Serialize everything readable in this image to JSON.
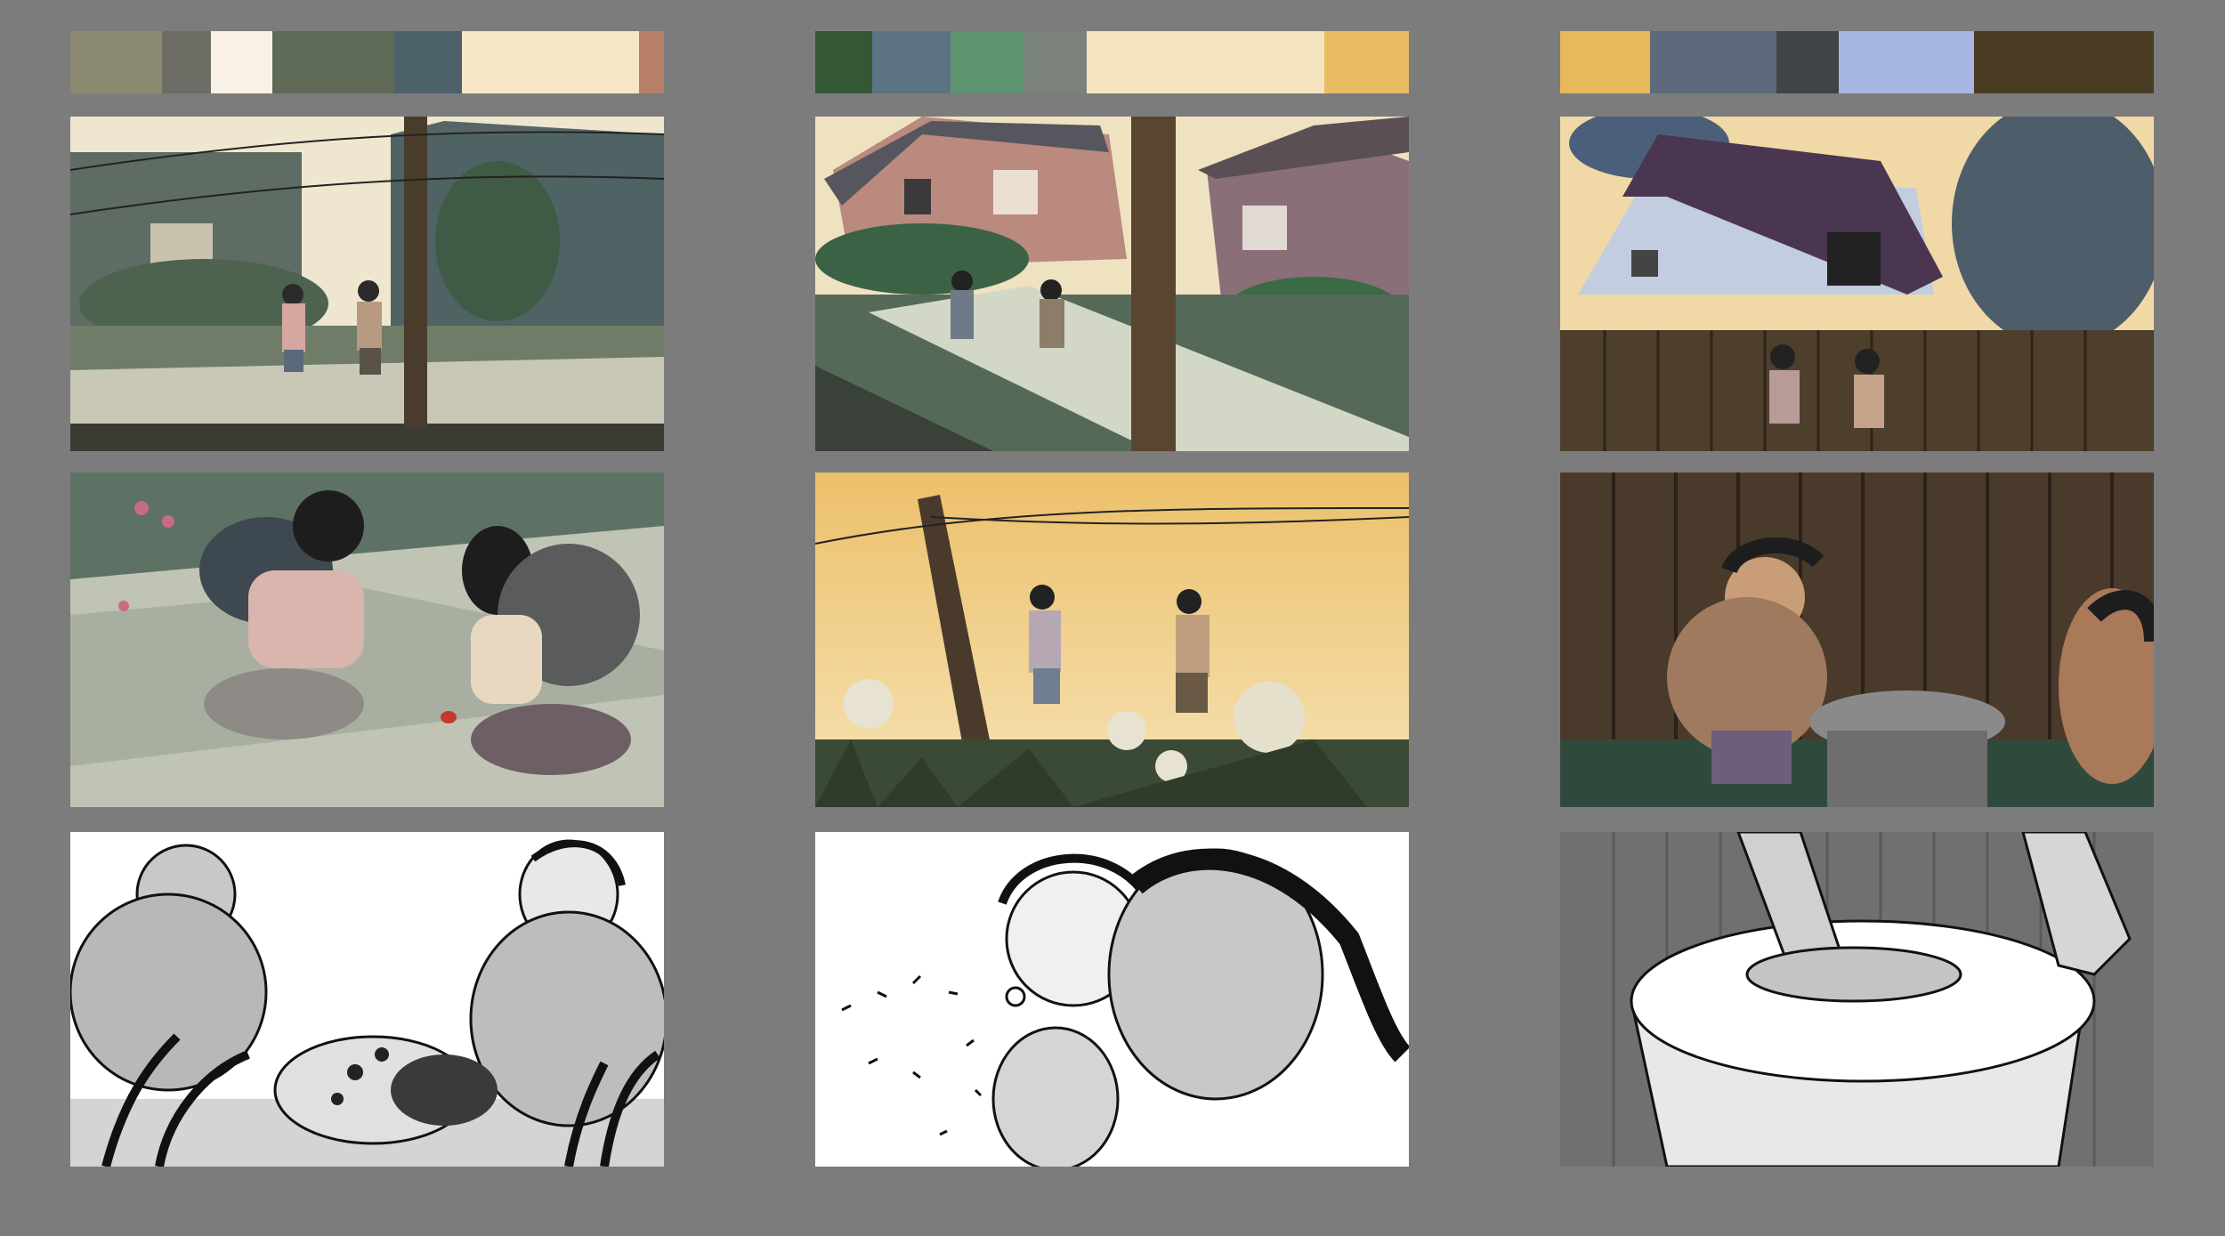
{
  "palettes": [
    {
      "swatches": [
        {
          "color": "#8b8970",
          "weight": 1.5
        },
        {
          "color": "#6e6d65",
          "weight": 0.8
        },
        {
          "color": "#faf1e6",
          "weight": 1.0
        },
        {
          "color": "#5f6a56",
          "weight": 2.0
        },
        {
          "color": "#4c616a",
          "weight": 1.1
        },
        {
          "color": "#f4e6c6",
          "weight": 2.9
        },
        {
          "color": "#b77f67",
          "weight": 0.4
        }
      ]
    },
    {
      "swatches": [
        {
          "color": "#345836",
          "weight": 1.0
        },
        {
          "color": "#5b7383",
          "weight": 1.4
        },
        {
          "color": "#5e9470",
          "weight": 1.3
        },
        {
          "color": "#7b827c",
          "weight": 1.1
        },
        {
          "color": "#f3e4bf",
          "weight": 4.2
        },
        {
          "color": "#e9bc63",
          "weight": 1.5
        }
      ]
    },
    {
      "swatches": [
        {
          "color": "#e8b85c",
          "weight": 1.0
        },
        {
          "color": "#5c6a7c",
          "weight": 1.4
        },
        {
          "color": "#404447",
          "weight": 0.7
        },
        {
          "color": "#a8b7e2",
          "weight": 1.5
        },
        {
          "color": "#4a3c22",
          "weight": 2.0
        }
      ]
    }
  ],
  "frames": [
    {
      "row": 0,
      "col": 0,
      "scene": "girls-walking-sidewalk-utility-pole",
      "style": "color"
    },
    {
      "row": 0,
      "col": 1,
      "scene": "girls-walking-past-houses-curved-sidewalk",
      "style": "color"
    },
    {
      "row": 0,
      "col": 2,
      "scene": "girls-walking-by-fence-white-house",
      "style": "color"
    },
    {
      "row": 1,
      "col": 0,
      "scene": "girls-crouching-looking-at-ladybug",
      "style": "color"
    },
    {
      "row": 1,
      "col": 1,
      "scene": "girls-walking-through-dandelions-sunset",
      "style": "color"
    },
    {
      "row": 1,
      "col": 2,
      "scene": "girls-lifting-trash-can-lid-by-fence",
      "style": "color"
    },
    {
      "row": 2,
      "col": 0,
      "scene": "sketch-girls-watching-ladybug-in-grass",
      "style": "sketch"
    },
    {
      "row": 2,
      "col": 1,
      "scene": "sketch-girls-blowing-dandelion-seeds",
      "style": "sketch"
    },
    {
      "row": 2,
      "col": 2,
      "scene": "sketch-trash-can-lid-with-legs",
      "style": "sketch"
    }
  ]
}
